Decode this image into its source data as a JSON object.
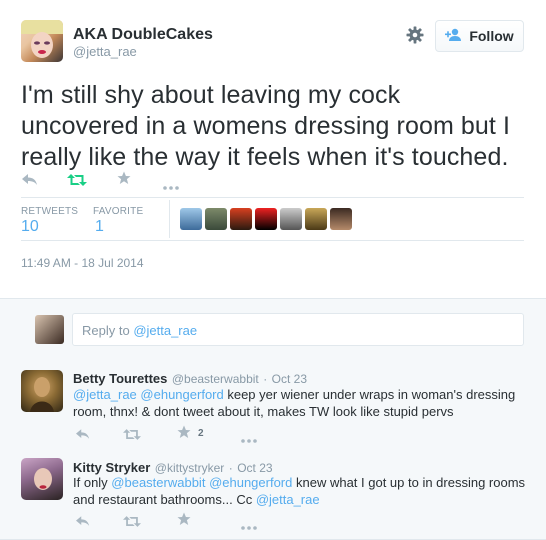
{
  "tweet": {
    "fullname": "AKA DoubleCakes",
    "handle": "@jetta_rae",
    "follow_label": "Follow",
    "text_line1": "I'm still shy about leaving my cock",
    "text_line2": "uncovered in a womens dressing room but I",
    "text_line3": "really like the way it feels when it's touched.",
    "retweets_label": "RETWEETS",
    "retweets_count": "10",
    "favorites_label": "FAVORITE",
    "favorites_count": "1",
    "timestamp": "11:49 AM - 18 Jul 2014"
  },
  "reply_box": {
    "prefix": "Reply to ",
    "mention": "@jetta_rae"
  },
  "replies": [
    {
      "name": "Betty Tourettes",
      "handle": "@beasterwabbit",
      "sep": "·",
      "date": "Oct 23",
      "m1": "@jetta_rae",
      "m2": "@ehungerford",
      "t1": " keep yer wiener under wraps in woman's dressing",
      "line2": "room, thnx! &  dont tweet about it, makes TW look like stupid pervs",
      "fav_count": "2"
    },
    {
      "name": "Kitty Stryker",
      "handle": "@kittystryker",
      "sep": "·",
      "date": "Oct 23",
      "pre": "If only ",
      "m1": "@beasterwabbit",
      "m2": "@ehungerford",
      "t1": " knew what I got up to in dressing rooms",
      "line2": "and restaurant bathrooms... Cc ",
      "m3": "@jetta_rae"
    }
  ],
  "colors": {
    "link": "#55acee",
    "retweet_green": "#19cf86",
    "muted": "#aab8c2"
  }
}
